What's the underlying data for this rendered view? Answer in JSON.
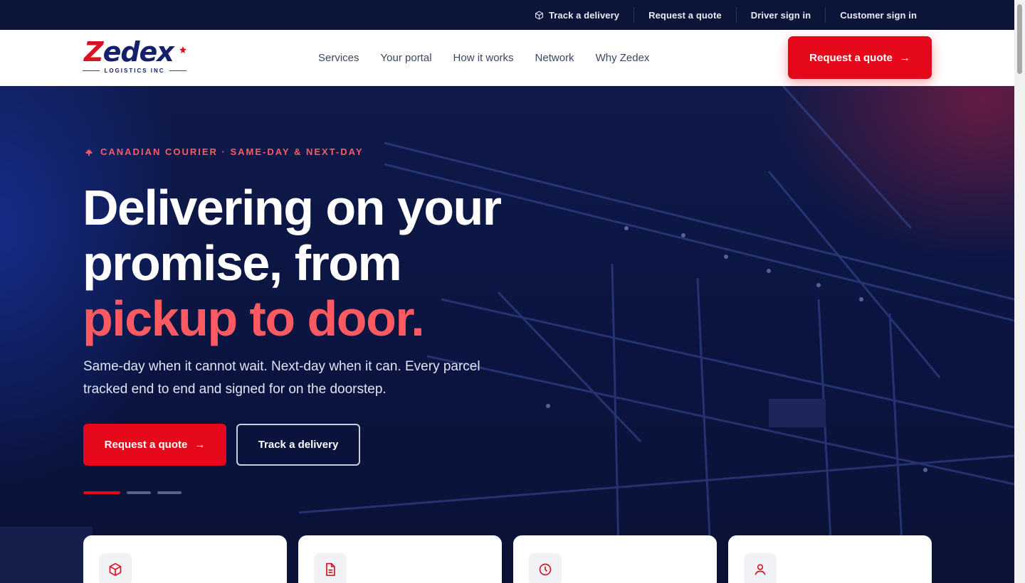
{
  "utility": {
    "links": [
      {
        "label": "Track a delivery",
        "icon": "package-icon"
      },
      {
        "label": "Request a quote"
      },
      {
        "label": "Driver sign in"
      },
      {
        "label": "Customer sign in"
      }
    ]
  },
  "brand": {
    "name_first": "Z",
    "name_rest": "edex",
    "tagline": "LOGISTICS INC",
    "accent_color": "#e4081a",
    "navy_color": "#14206b"
  },
  "nav": {
    "links": [
      "Services",
      "Your portal",
      "How it works",
      "Network",
      "Why Zedex"
    ],
    "cta_label": "Request a quote",
    "cta_arrow": "→"
  },
  "hero": {
    "eyebrow": "CANADIAN COURIER · SAME-DAY & NEXT-DAY",
    "eyebrow_icon": "maple-leaf-icon",
    "headline_line1": "Delivering on your",
    "headline_line2": "promise, from",
    "headline_accent": "pickup to door.",
    "lede": "Same-day when it cannot wait. Next-day when it can. Every parcel tracked end to end and signed for on the doorstep.",
    "primary_cta": "Request a quote",
    "primary_arrow": "→",
    "secondary_cta": "Track a delivery",
    "slides_total": 3,
    "slide_active": 1
  },
  "cards": [
    {
      "icon": "package-icon"
    },
    {
      "icon": "document-icon"
    },
    {
      "icon": "clock-icon"
    },
    {
      "icon": "user-icon"
    }
  ]
}
